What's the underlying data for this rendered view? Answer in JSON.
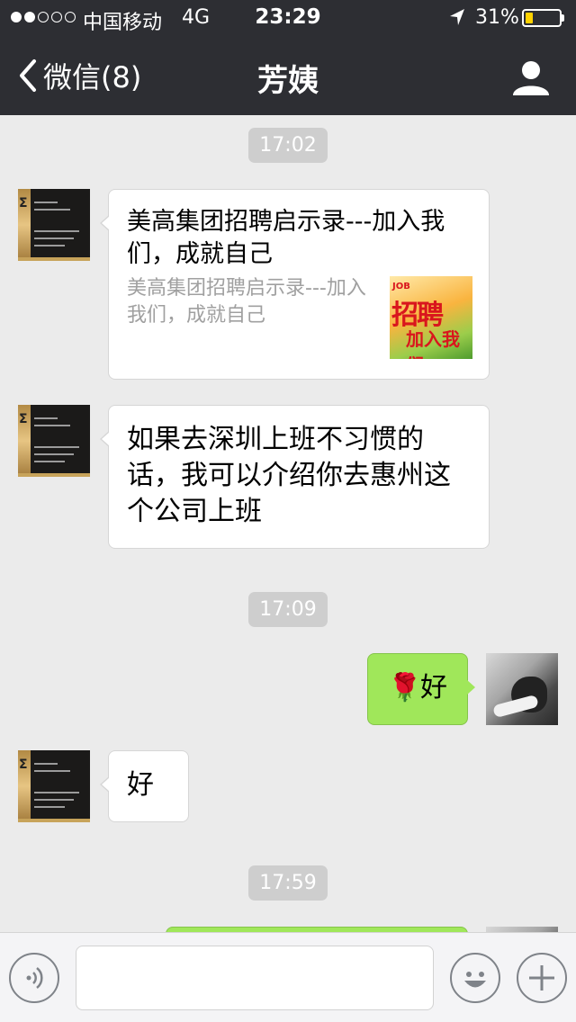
{
  "status_bar": {
    "carrier": "中国移动",
    "network": "4G",
    "time": "23:29",
    "battery_percent": "31%",
    "battery_level": 0.31,
    "signal_bars_filled": 2,
    "signal_bars_total": 5
  },
  "nav": {
    "back_label": "微信(8)",
    "title": "芳姨"
  },
  "chat": {
    "timestamps": [
      "17:02",
      "17:09",
      "17:59"
    ],
    "link_message": {
      "title": "美高集团招聘启示录---加入我们，成就自己",
      "description": "美高集团招聘启示录---加入我们，成就自己",
      "thumb_job": "JOB",
      "thumb_main": "招聘",
      "thumb_sub": "加入我们"
    },
    "message_2": "如果去深圳上班不习惯的话，我可以介绍你去惠州这个公司上班",
    "message_self": "好",
    "message_self_emoji": "🌹",
    "message_4": "好"
  },
  "input_bar": {
    "placeholder": ""
  },
  "colors": {
    "nav_bg": "#2d2e33",
    "chat_bg": "#ebebeb",
    "self_bubble": "#a0e75a",
    "timestamp_bg": "#cecece",
    "battery": "#ffd200"
  }
}
